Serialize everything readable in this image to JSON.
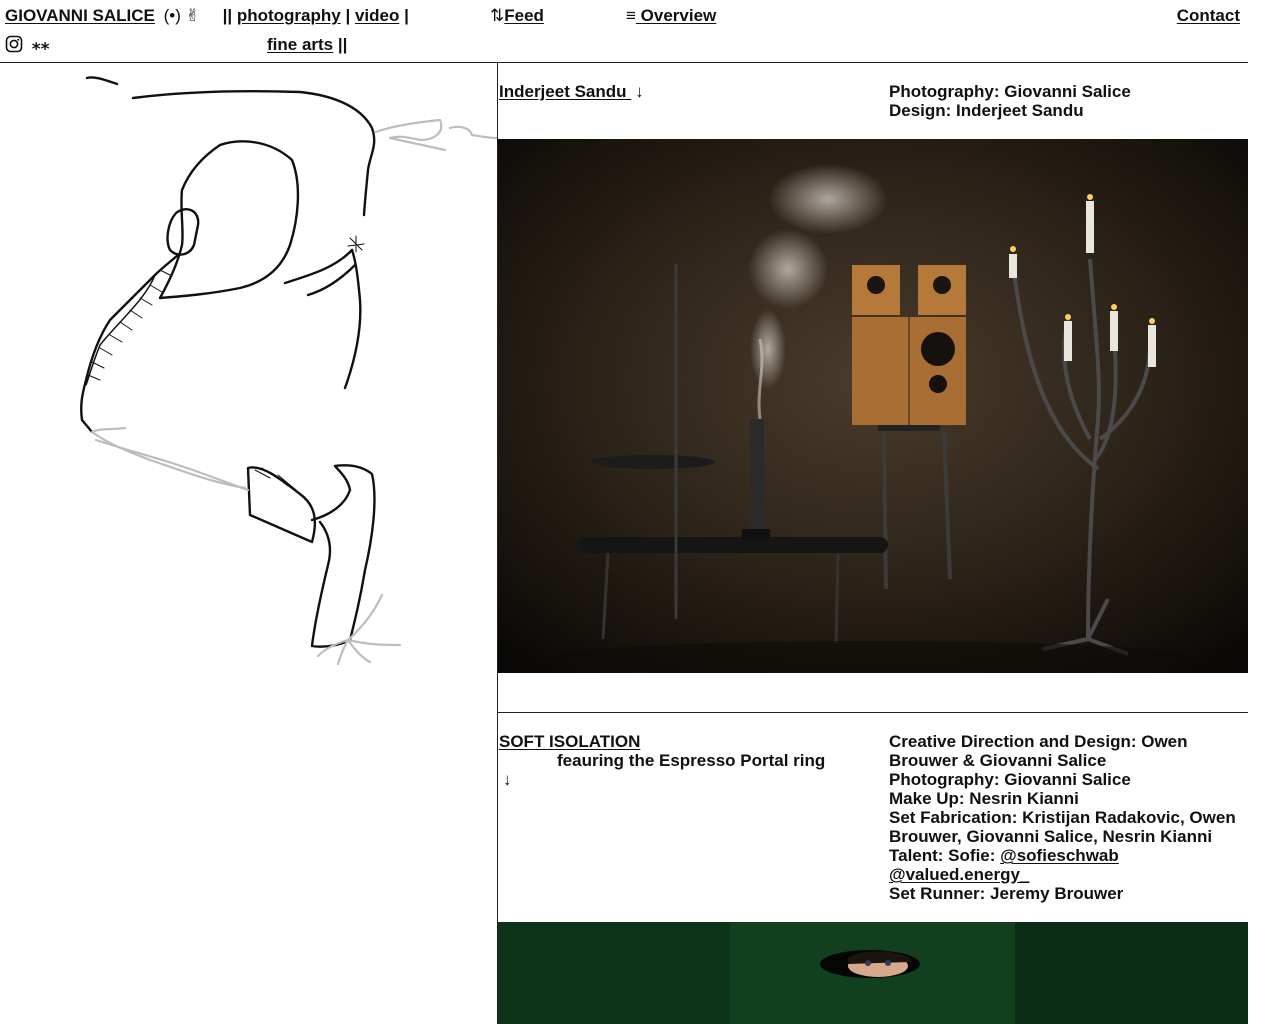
{
  "header": {
    "brand": "GIOVANNI SALICE",
    "brand_icons": "(•) ✌",
    "nav_open": "||",
    "nav_photography": "photography",
    "nav_pipe": "|",
    "nav_video": "video",
    "nav_pipe2": "|",
    "nav_fine_arts": "fine arts",
    "nav_close": "||",
    "stars": "⁎⁎",
    "feed_icon": "⇅",
    "feed": "Feed",
    "overview_icon": "≡",
    "overview": " Overview",
    "contact": "Contact",
    "instagram_icon": "instagram-icon"
  },
  "projects": [
    {
      "title": "Inderjeet Sandu ",
      "arrow": "↓",
      "credits": [
        "Photography: Giovanni Salice",
        "Design: Inderjeet Sandu"
      ]
    },
    {
      "title": "SOFT ISOLATION",
      "subtitle": "feauring the Espresso Portal ring",
      "arrow": "↓",
      "credits_a": "Creative Direction and Design: Owen Brouwer & Giovanni Salice",
      "credits_b": "Photography: Giovanni Salice",
      "credits_c": "Make Up: Nesrin Kianni",
      "credits_d": "Set Fabrication: Kristijan Radakovic, Owen Brouwer, Giovanni Salice, Nesrin Kianni",
      "talent_label": "Talent: Sofie: ",
      "talent_link1": "@sofieschwab",
      "talent_link2": "@valued.energy_",
      "credits_e": "Set Runner: Jeremy Brouwer"
    }
  ],
  "colors": {
    "photo1_bg": "#2a2219",
    "photo2_bg": "#0f3a1c",
    "speaker": "#b5793a"
  }
}
